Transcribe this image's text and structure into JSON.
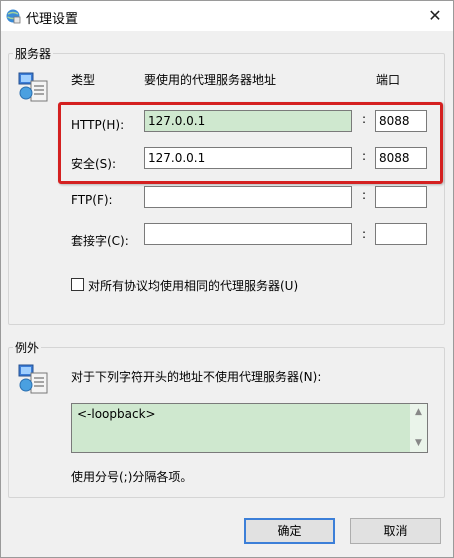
{
  "window": {
    "title": "代理设置",
    "close": "✕"
  },
  "servers": {
    "group_label": "服务器",
    "header_type": "类型",
    "header_address": "要使用的代理服务器地址",
    "header_port": "端口",
    "rows": [
      {
        "label": "HTTP(H):",
        "address": "127.0.0.1",
        "port": "8088"
      },
      {
        "label": "安全(S):",
        "address": "127.0.0.1",
        "port": "8088"
      },
      {
        "label": "FTP(F):",
        "address": "",
        "port": ""
      },
      {
        "label": "套接字(C):",
        "address": "",
        "port": ""
      }
    ],
    "colon": ":",
    "same_proxy_label": "对所有协议均使用相同的代理服务器(U)",
    "same_proxy_checked": false
  },
  "exceptions": {
    "group_label": "例外",
    "description": "对于下列字符开头的地址不使用代理服务器(N):",
    "value": "<-loopback>",
    "hint": "使用分号(;)分隔各项。"
  },
  "buttons": {
    "ok": "确定",
    "cancel": "取消"
  },
  "colors": {
    "highlight_green": "#cfe8cf",
    "annotation_red": "#d42020",
    "default_button_border": "#3c7fd8"
  }
}
